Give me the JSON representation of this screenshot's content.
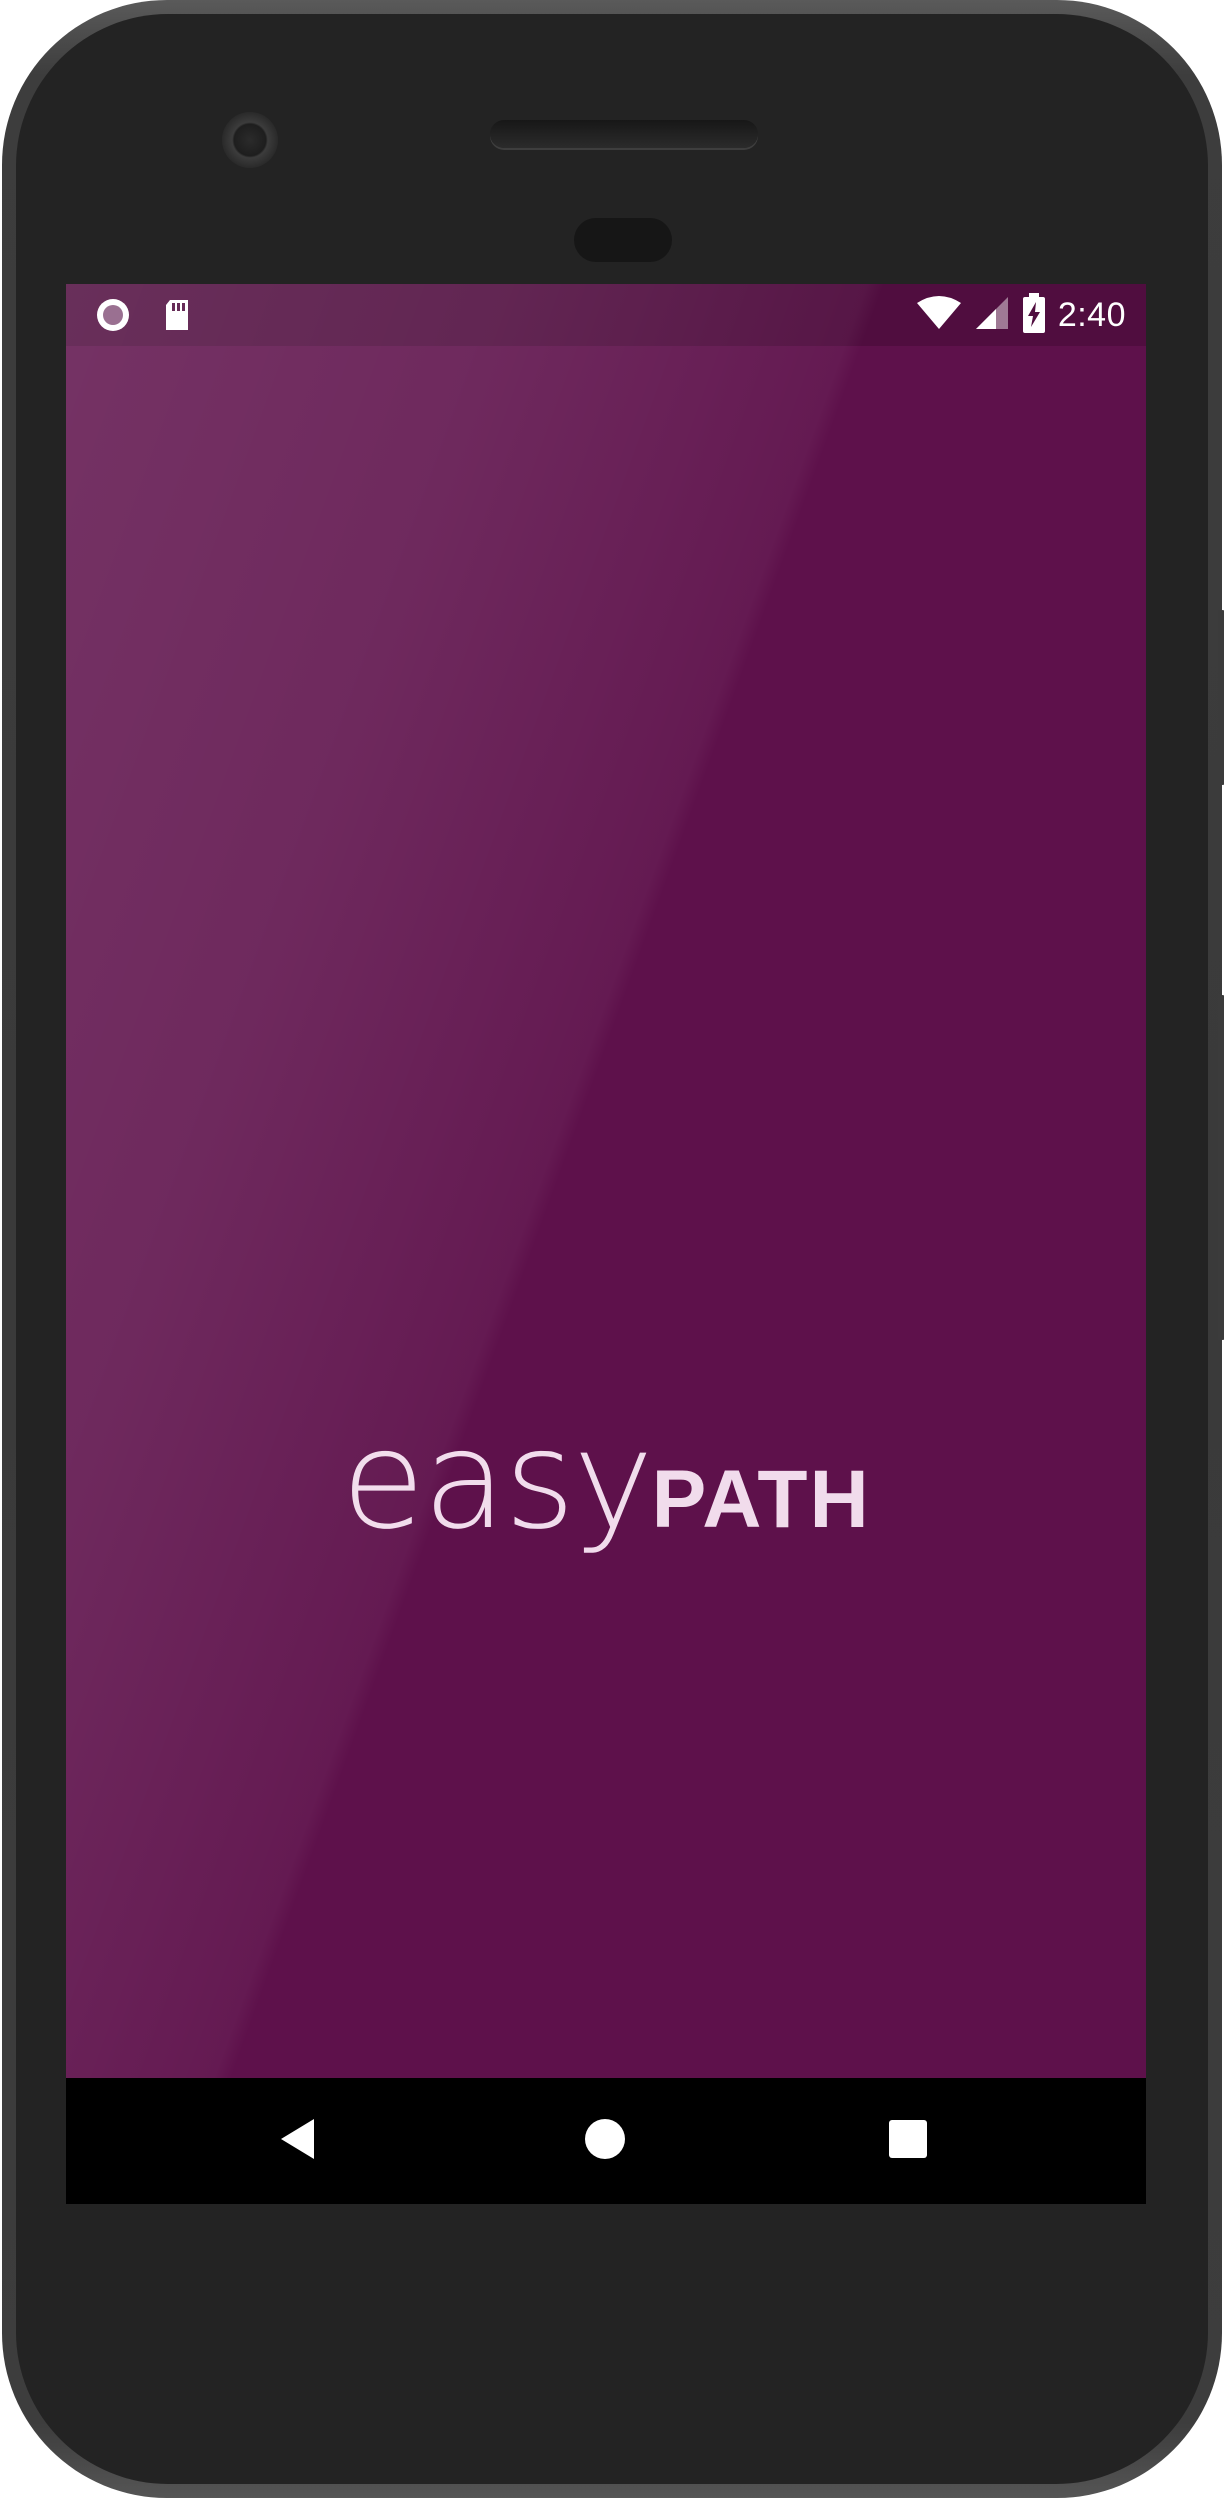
{
  "status_bar": {
    "time": "2:40",
    "left_icons": [
      "record-indicator-icon",
      "sd-card-icon"
    ],
    "right_icons": [
      "wifi-icon",
      "cell-signal-icon",
      "battery-charging-icon"
    ]
  },
  "splash": {
    "logo_word_1": "easy",
    "logo_word_2": "PATH",
    "background_color": "#5e114b",
    "logo_color": "#f1dcec"
  },
  "nav_bar": {
    "buttons": [
      "back-icon",
      "home-icon",
      "recents-icon"
    ]
  }
}
